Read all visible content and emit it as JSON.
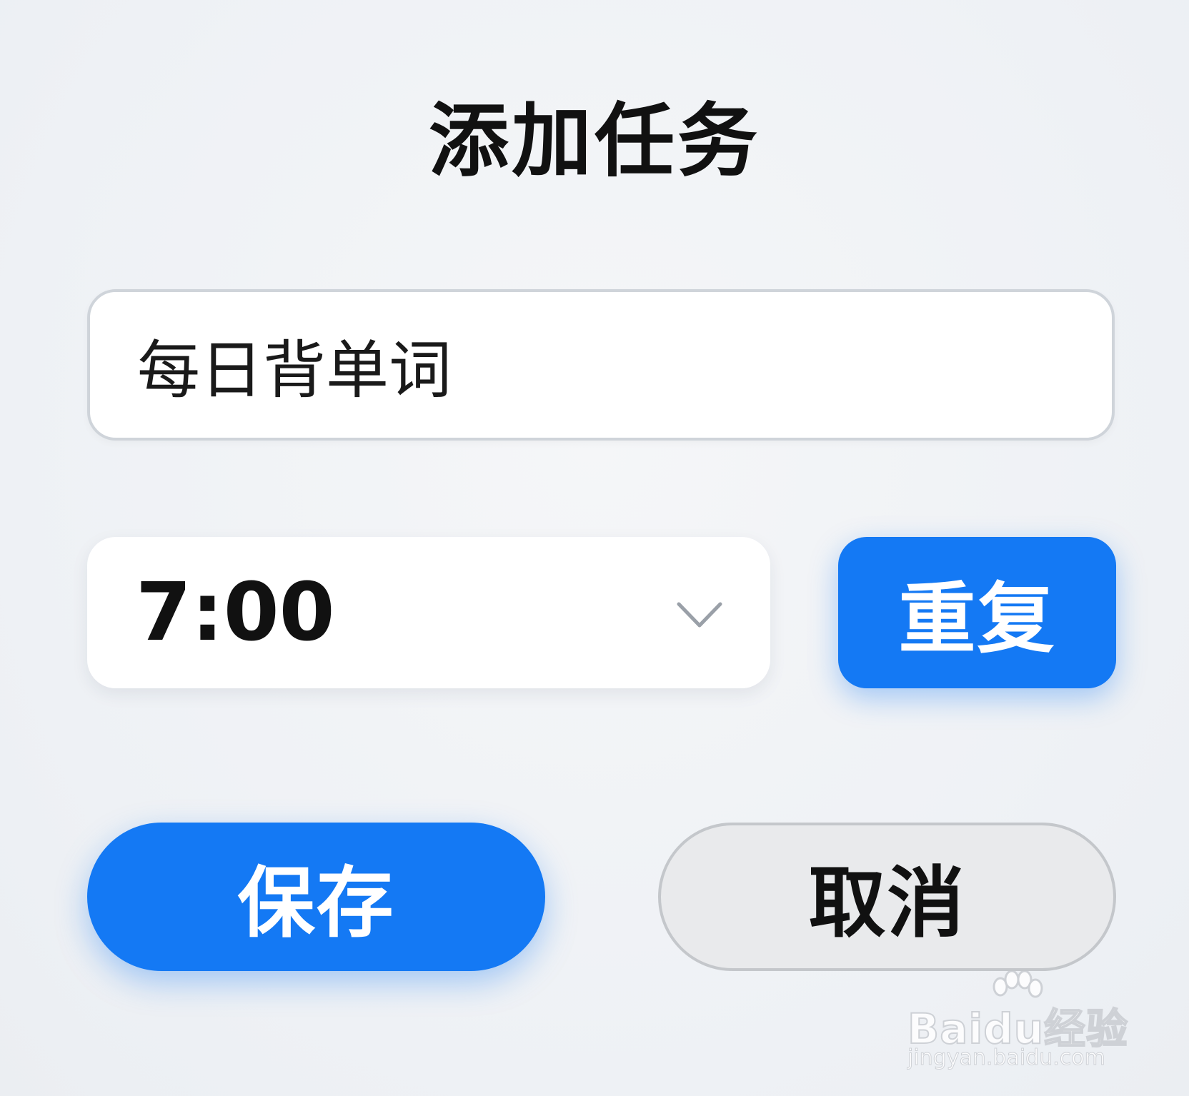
{
  "dialog": {
    "title": "添加任务"
  },
  "task_name": {
    "value": "每日背单词"
  },
  "time": {
    "selected": "7:00"
  },
  "buttons": {
    "repeat": "重复",
    "save": "保存",
    "cancel": "取消"
  },
  "watermark": {
    "brand": "Baidu经验",
    "url": "jingyan.baidu.com"
  },
  "colors": {
    "accent": "#1479f4",
    "background": "#f1f3f6",
    "cancel_bg": "#e9eaec"
  }
}
